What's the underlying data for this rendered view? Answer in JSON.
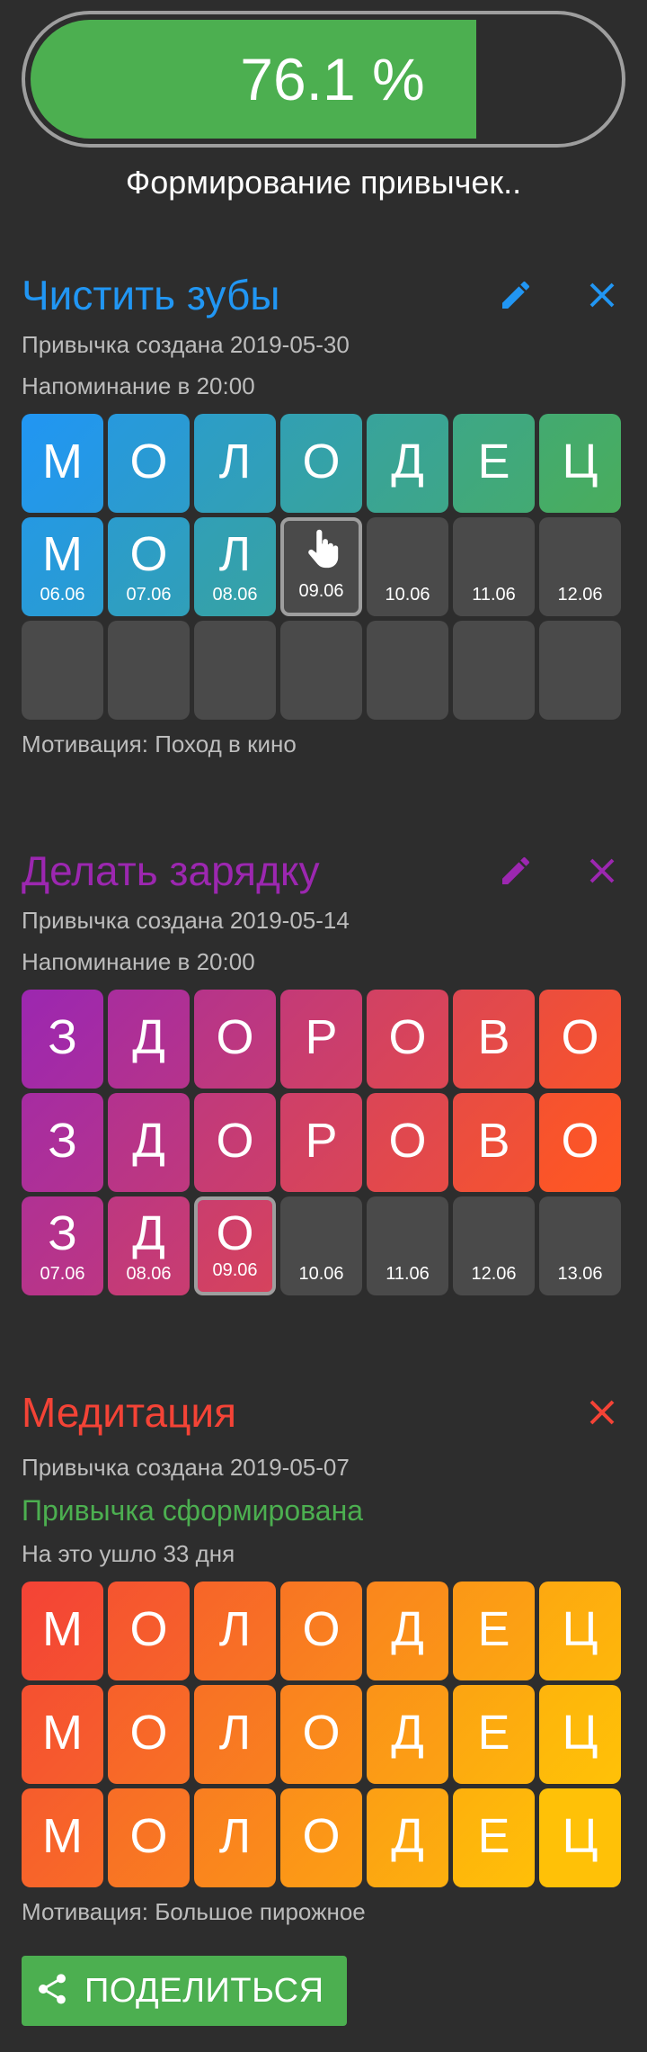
{
  "progress": {
    "value_fraction": 0.761,
    "label": "76.1 %",
    "caption": "Формирование привычек.."
  },
  "colors": {
    "blue": "#2196f3",
    "purple": "#9c27b0",
    "red": "#f44336",
    "green": "#4caf50"
  },
  "habits": [
    {
      "title": "Чистить зубы",
      "color": "#2196f3",
      "created": "Привычка создана 2019-05-30",
      "reminder": "Напоминание в 20:00",
      "word": [
        "М",
        "О",
        "Л",
        "О",
        "Д",
        "Е",
        "Ц"
      ],
      "row2": [
        {
          "letter": "М",
          "date": "06.06"
        },
        {
          "letter": "О",
          "date": "07.06"
        },
        {
          "letter": "Л",
          "date": "08.06"
        },
        {
          "letter": "",
          "date": "09.06",
          "today": true,
          "icon": "tap-hand-icon"
        },
        {
          "letter": "",
          "date": "10.06"
        },
        {
          "letter": "",
          "date": "11.06"
        },
        {
          "letter": "",
          "date": "12.06"
        }
      ],
      "motivation": "Мотивация: Поход в кино"
    },
    {
      "title": "Делать зарядку",
      "color": "#9c27b0",
      "created": "Привычка создана 2019-05-14",
      "reminder": "Напоминание в 20:00",
      "word": [
        "З",
        "Д",
        "О",
        "Р",
        "О",
        "В",
        "О"
      ],
      "row3": [
        {
          "letter": "З",
          "date": "07.06"
        },
        {
          "letter": "Д",
          "date": "08.06"
        },
        {
          "letter": "О",
          "date": "09.06",
          "today": true
        },
        {
          "letter": "",
          "date": "10.06"
        },
        {
          "letter": "",
          "date": "11.06"
        },
        {
          "letter": "",
          "date": "12.06"
        },
        {
          "letter": "",
          "date": "13.06"
        }
      ]
    },
    {
      "title": "Медитация",
      "color": "#f44336",
      "created": "Привычка создана 2019-05-07",
      "formed": "Привычка сформирована",
      "duration": "На это ушло 33 дня",
      "word": [
        "М",
        "О",
        "Л",
        "О",
        "Д",
        "Е",
        "Ц"
      ],
      "motivation": "Мотивация: Большое пирожное"
    }
  ],
  "share": {
    "label": "ПОДЕЛИТЬСЯ",
    "icon": "share-icon"
  }
}
